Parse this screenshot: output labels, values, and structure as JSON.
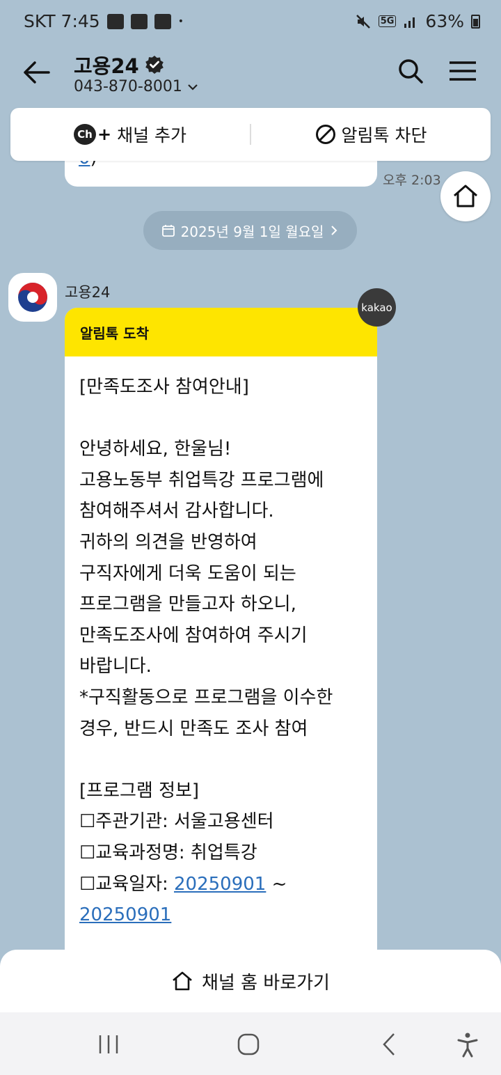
{
  "status_bar": {
    "carrier_time": "SKT 7:45",
    "dot": "•",
    "network": "5G",
    "battery": "63%"
  },
  "header": {
    "channel_name": "고용24",
    "phone": "043-870-8001"
  },
  "actions": {
    "channel_icon": "Ch",
    "add_channel": "채널 추가",
    "block_alimtalk": "알림톡 차단"
  },
  "prev_message": {
    "link_fragment": "0",
    "trailing": ")",
    "time": "오후 2:03"
  },
  "date_divider": "2025년 9월 1일 월요일",
  "sender": {
    "name": "고용24",
    "badge": "kakao"
  },
  "message": {
    "header": "알림톡 도착",
    "lines": [
      "[만족도조사 참여안내]",
      "",
      "안녕하세요, 한울님!",
      "고용노동부 취업특강 프로그램에",
      "참여해주셔서 감사합니다.",
      "귀하의 의견을 반영하여",
      "구직자에게 더욱 도움이 되는",
      "프로그램을 만들고자 하오니,",
      "만족도조사에 참여하여 주시기",
      "바랍니다.",
      "*구직활동으로 프로그램을 이수한",
      "경우, 반드시 만족도 조사 참여",
      "",
      "[프로그램 정보]",
      "☐주관기관: 서울고용센터",
      "☐교육과정명: 취업특강"
    ],
    "date_label": "☐교육일자: ",
    "date_start": "20250901",
    "date_sep": " ~",
    "date_end": "20250901"
  },
  "bottom_button": "채널 홈 바로가기"
}
